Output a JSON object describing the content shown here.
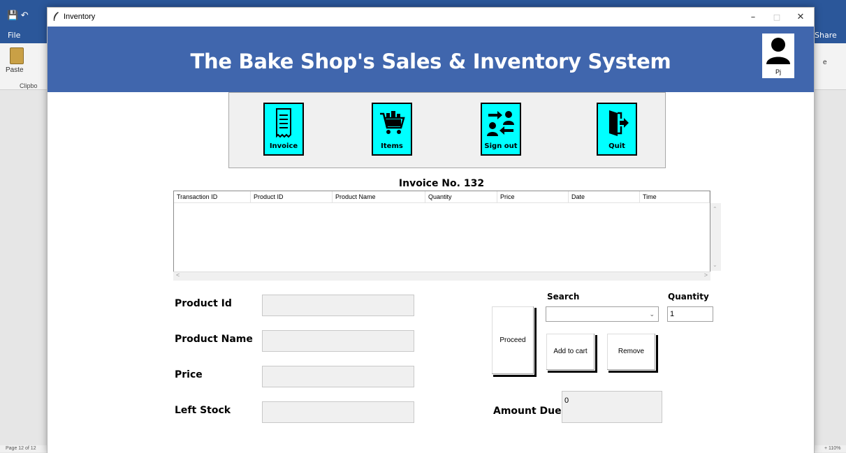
{
  "word": {
    "file_tab": "File",
    "share": "Share",
    "paste": "Paste",
    "clipboard": "Clipbo",
    "ribbon_right": "e",
    "status_left": "Page 12 of 12",
    "status_right": "+ 110%"
  },
  "window": {
    "title": "Inventory",
    "minimize": "–",
    "maximize": "□",
    "close": "✕"
  },
  "header": {
    "title": "The Bake Shop's Sales & Inventory System",
    "user_name": "Pj"
  },
  "nav": {
    "invoice": "Invoice",
    "items": "Items",
    "sign_out": "Sign out",
    "quit": "Quit"
  },
  "invoice": {
    "title": "Invoice No. 132",
    "columns": [
      "Transaction ID",
      "Product ID",
      "Product Name",
      "Quantity",
      "Price",
      "Date",
      "Time"
    ],
    "rows": []
  },
  "form": {
    "product_id_label": "Product Id",
    "product_name_label": "Product Name",
    "price_label": "Price",
    "left_stock_label": "Left Stock",
    "product_id_value": "",
    "product_name_value": "",
    "price_value": "",
    "left_stock_value": ""
  },
  "cart": {
    "proceed": "Proceed",
    "search_label": "Search",
    "search_value": "",
    "quantity_label": "Quantity",
    "quantity_value": "1",
    "add_to_cart": "Add to cart",
    "remove": "Remove",
    "amount_due_label": "Amount Due",
    "amount_due_value": "0"
  },
  "colors": {
    "header_bg": "#4066ad",
    "nav_button_bg": "#00ffff",
    "word_blue": "#2b579a"
  },
  "icons": [
    "receipt-icon",
    "shopping-cart-icon",
    "switch-user-icon",
    "exit-door-icon",
    "user-avatar-icon"
  ]
}
